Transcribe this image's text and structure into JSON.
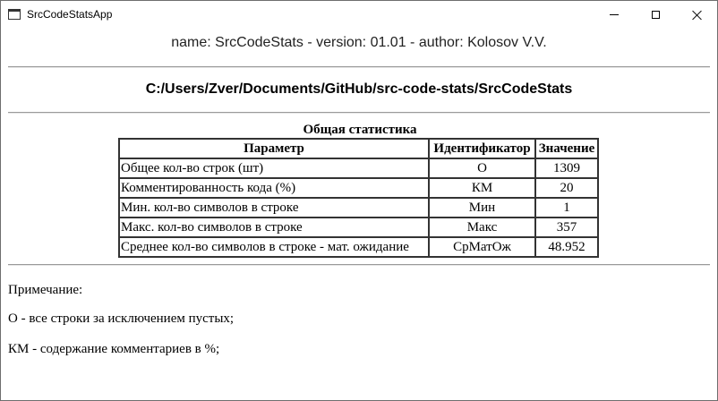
{
  "window": {
    "title": "SrcCodeStatsApp",
    "controls": {
      "minimize": "minimize",
      "maximize": "maximize",
      "close": "close"
    }
  },
  "header": {
    "info": "name: SrcCodeStats - version: 01.01 - author: Kolosov V.V.",
    "path": "C:/Users/Zver/Documents/GitHub/src-code-stats/SrcCodeStats"
  },
  "stats_table": {
    "caption": "Общая статистика",
    "columns": [
      "Параметр",
      "Идентификатор",
      "Значение"
    ],
    "rows": [
      {
        "param": "Общее кол-во строк (шт)",
        "ident": "О",
        "value": "1309"
      },
      {
        "param": "Комментированность кода (%)",
        "ident": "КМ",
        "value": "20"
      },
      {
        "param": "Мин. кол-во символов в строке",
        "ident": "Мин",
        "value": "1"
      },
      {
        "param": "Макс. кол-во символов в строке",
        "ident": "Макс",
        "value": "357"
      },
      {
        "param": "Среднее кол-во символов в строке - мат. ожидание",
        "ident": "СрМатОж",
        "value": "48.952"
      }
    ]
  },
  "notes": {
    "title": "Примечание:",
    "items": [
      "О - все строки за исключением пустых;",
      "КМ - содержание комментариев в %;"
    ]
  }
}
